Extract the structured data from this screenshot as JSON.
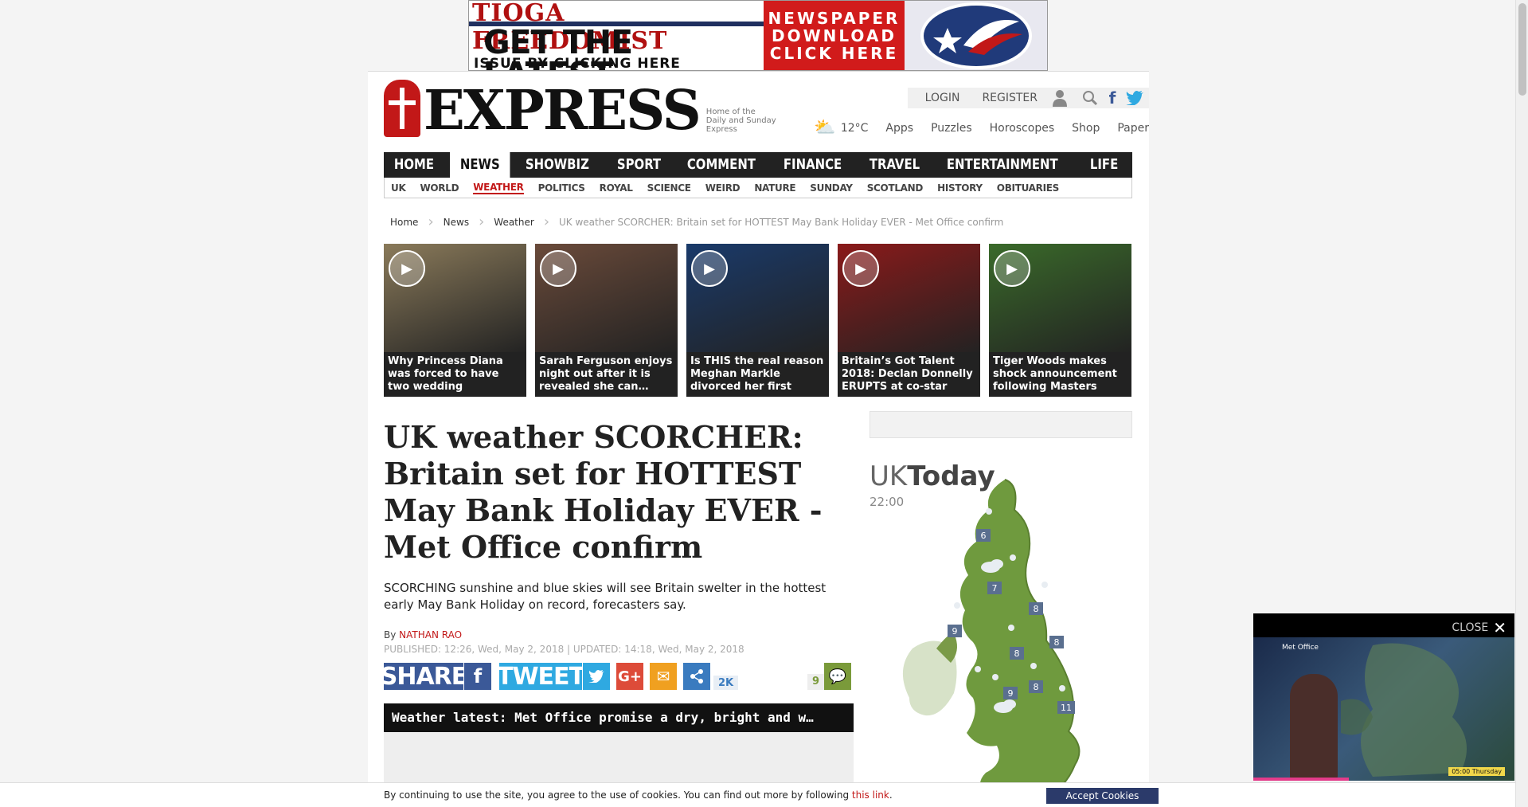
{
  "banner": {
    "brand": "TIOGA FREEDOMIST",
    "line1": "GET THE LATEST",
    "line2": "ISSUE BY CLICKING HERE",
    "cta": [
      "NEWSPAPER",
      "DOWNLOAD",
      "CLICK HERE"
    ]
  },
  "site": {
    "logo": "EXPRESS",
    "tagline": "Home of the Daily and Sunday Express",
    "login": "LOGIN",
    "register": "REGISTER",
    "temperature": "12°C",
    "links": [
      "Apps",
      "Puzzles",
      "Horoscopes",
      "Shop",
      "Paper"
    ]
  },
  "nav": [
    "HOME",
    "NEWS",
    "SHOWBIZ & TV",
    "SPORT",
    "COMMENT",
    "FINANCE",
    "TRAVEL",
    "ENTERTAINMENT",
    "LIFE & STYLE"
  ],
  "subnav": [
    "UK",
    "WORLD",
    "WEATHER",
    "POLITICS",
    "ROYAL",
    "SCIENCE",
    "WEIRD",
    "NATURE",
    "SUNDAY",
    "SCOTLAND",
    "HISTORY",
    "OBITUARIES"
  ],
  "breadcrumb": [
    "Home",
    "News",
    "Weather",
    "UK weather SCORCHER: Britain set for HOTTEST May Bank Holiday EVER - Met Office confirm"
  ],
  "tiles": [
    {
      "caption": "Why Princess Diana was forced to have two wedding",
      "color": "#8a7a5a"
    },
    {
      "caption": "Sarah Ferguson enjoys night out after it is revealed she can…",
      "color": "#6a4a3a"
    },
    {
      "caption": "Is THIS the real reason Meghan Markle divorced her first",
      "color": "#1a3a6a"
    },
    {
      "caption": "Britain’s Got Talent 2018: Declan Donnelly ERUPTS at co-star",
      "color": "#8a1a1a"
    },
    {
      "caption": "Tiger Woods makes shock announcement following Masters",
      "color": "#3a6a2a"
    }
  ],
  "article": {
    "headline": "UK weather SCORCHER: Britain set for HOTTEST May Bank Holiday EVER - Met Office confirm",
    "standfirst": "SCORCHING sunshine and blue skies will see Britain swelter in the hottest early May Bank Holiday on record, forecasters say.",
    "by": "By",
    "author": "NATHAN RAO",
    "published": "PUBLISHED: 12:26, Wed, May 2, 2018 | UPDATED: 14:18, Wed, May 2, 2018",
    "share_label": "SHARE",
    "tweet_label": "TWEET",
    "share_count": "2K",
    "comment_count": "9",
    "video_title": "Weather latest: Met Office promise a dry, bright and w…"
  },
  "weather_widget": {
    "title_a": "UK",
    "title_b": "Today",
    "time": "22:00",
    "temps": [
      "6",
      "7",
      "8",
      "9",
      "8",
      "8",
      "9",
      "8",
      "11"
    ]
  },
  "cookie": {
    "text": "By continuing to use the site, you agree to the use of cookies. You can find out more by following",
    "link": "this link",
    "end": ".",
    "button": "Accept Cookies"
  },
  "video_popup": {
    "close": "CLOSE",
    "brand": "Met Office",
    "stamp": "05:00 Thursday"
  },
  "colors": {
    "brand_red": "#c21818",
    "facebook": "#3b5998",
    "twitter": "#2fa9e1"
  }
}
